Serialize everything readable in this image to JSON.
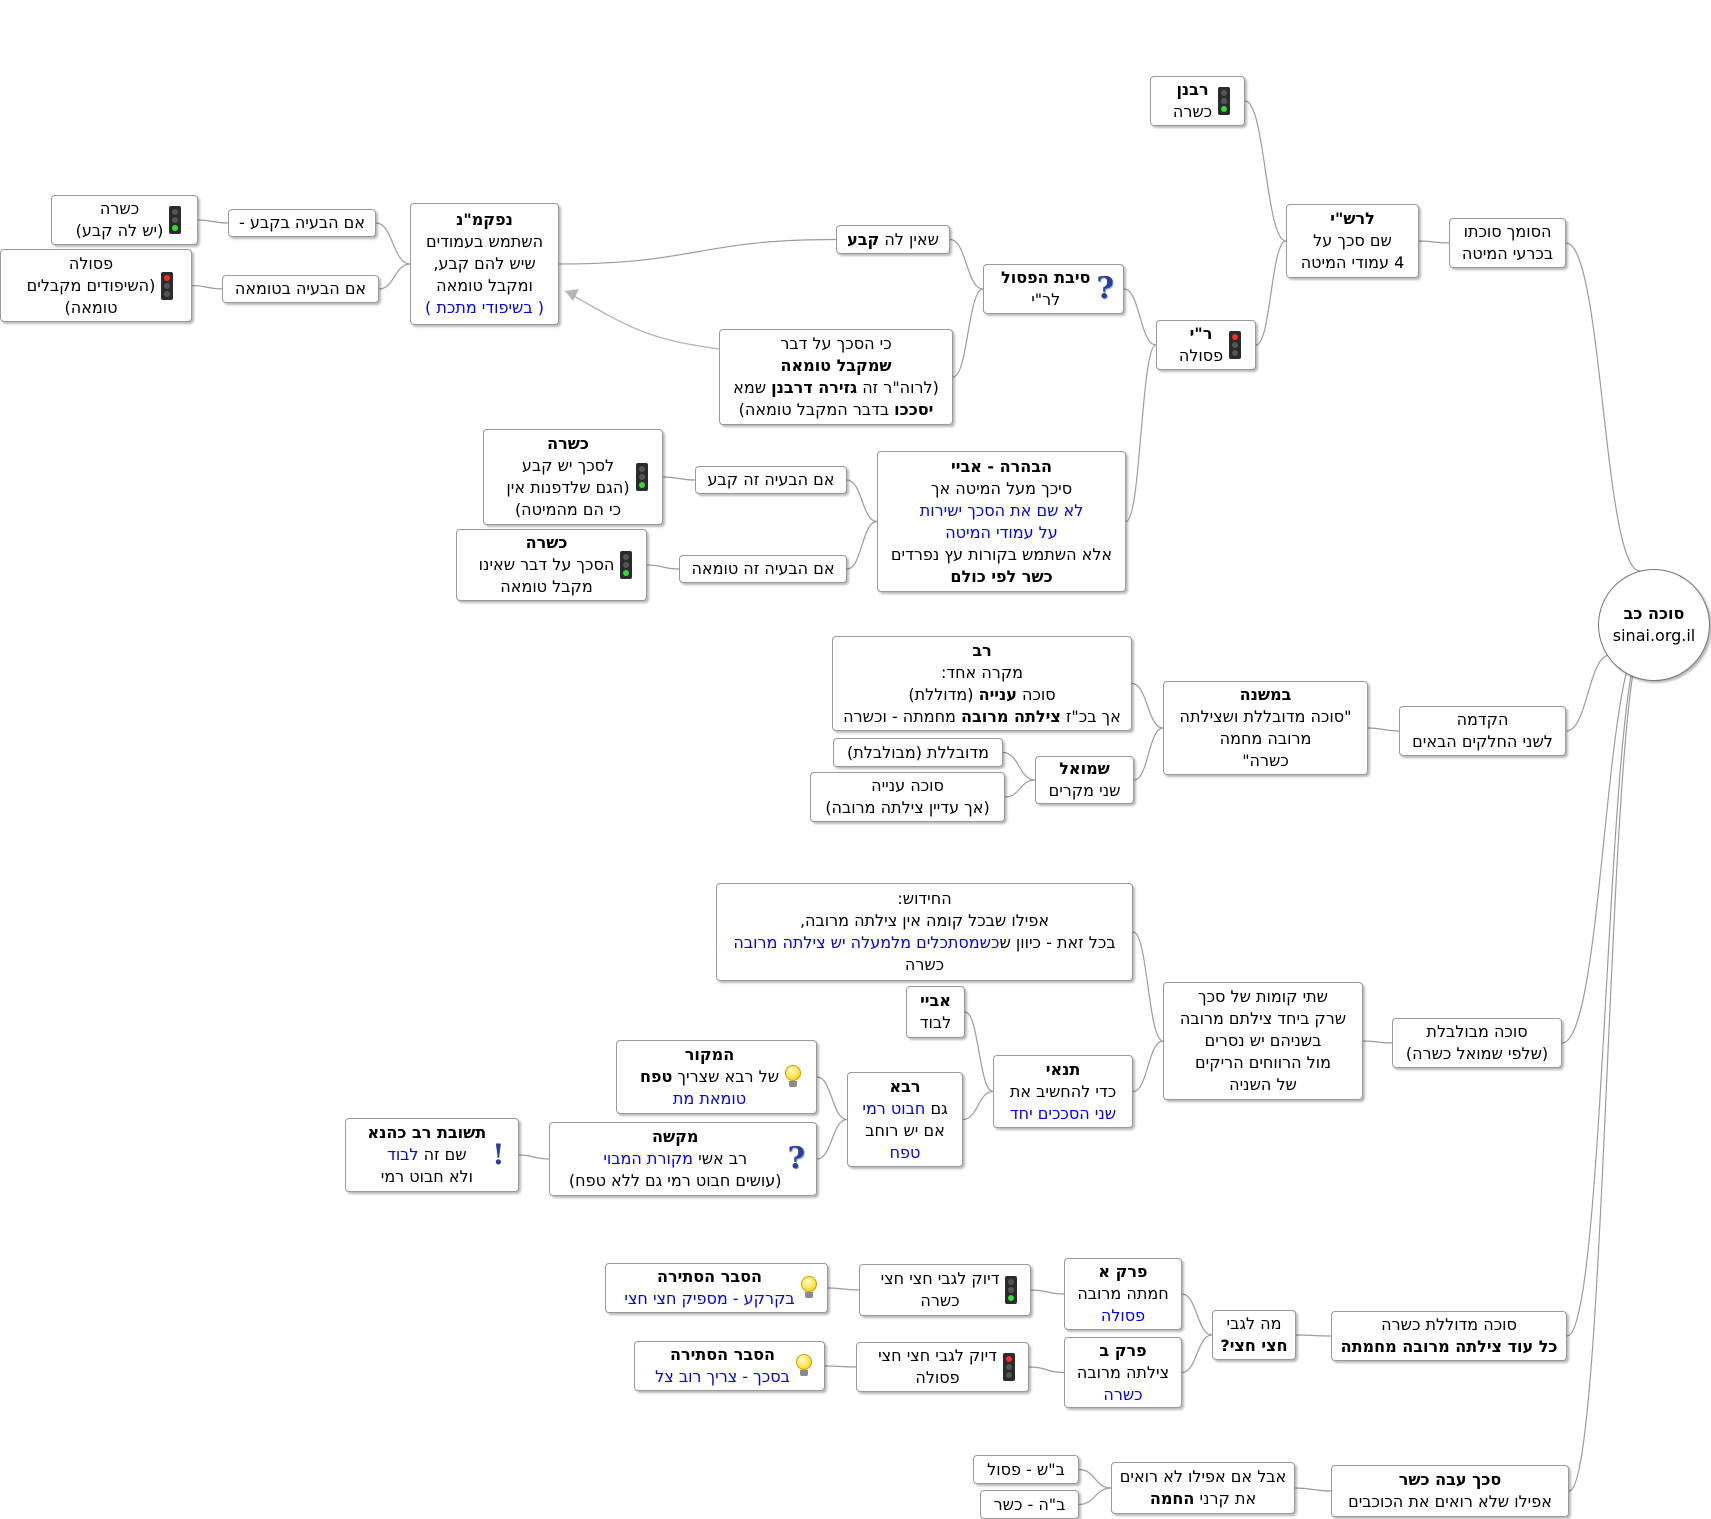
{
  "map": {
    "root": {
      "lines": [
        [
          {
            "t": "סוכה כב",
            "b": true
          }
        ],
        [
          {
            "t": "sinai.org.il"
          }
        ]
      ]
    },
    "n_mesukh": {
      "lines": [
        [
          {
            "t": "הסומך סוכתו"
          }
        ],
        [
          {
            "t": "בכרעי המיטה"
          }
        ]
      ]
    },
    "n_rashi_title": {
      "lines": [
        [
          {
            "t": "לרש\"י",
            "b": true
          }
        ],
        [
          {
            "t": "שם סכך על"
          }
        ],
        [
          {
            "t": "4 עמודי המיטה"
          }
        ]
      ]
    },
    "n_rabanan": {
      "icon": "traffic-light-green",
      "lines": [
        [
          {
            "t": "רבנן",
            "b": true
          }
        ],
        [
          {
            "t": "כשרה"
          }
        ]
      ]
    },
    "n_ri": {
      "icon": "traffic-light-red",
      "lines": [
        [
          {
            "t": "ר\"י",
            "b": true
          }
        ],
        [
          {
            "t": "פסולה"
          }
        ]
      ]
    },
    "n_sibat": {
      "icon": "question-mark",
      "lines": [
        [
          {
            "t": "סיבת הפסול",
            "b": true
          }
        ],
        [
          {
            "t": "לר\"י"
          }
        ]
      ]
    },
    "n_shein": {
      "lines": [
        [
          {
            "t": "שאין לה "
          },
          {
            "t": "קבע",
            "b": true
          }
        ]
      ]
    },
    "n_nafkamin": {
      "lines": [
        [
          {
            "t": "נפקמ\"נ",
            "b": true
          }
        ],
        [
          {
            "t": "השתמש בעמודים"
          }
        ],
        [
          {
            "t": "שיש להם קבע,"
          }
        ],
        [
          {
            "t": "ומקבל טומאה"
          }
        ],
        [
          {
            "t": "( בשיפודי מתכת )",
            "blue": true
          }
        ]
      ]
    },
    "n_kevaa": {
      "lines": [
        [
          {
            "t": "אם הבעיה בקבע -"
          }
        ]
      ]
    },
    "n_tumaa": {
      "lines": [
        [
          {
            "t": "אם הבעיה בטומאה"
          }
        ]
      ]
    },
    "n_kshera1": {
      "icon": "traffic-light-green",
      "lines": [
        [
          {
            "t": "כשרה"
          }
        ],
        [
          {
            "t": "(יש לה קבע)"
          }
        ]
      ]
    },
    "n_psula1": {
      "icon": "traffic-light-red",
      "lines": [
        [
          {
            "t": "פסולה"
          }
        ],
        [
          {
            "t": "(השיפודים מקבלים"
          }
        ],
        [
          {
            "t": "טומאה)"
          }
        ]
      ]
    },
    "n_ki_sekhakh": {
      "lines": [
        [
          {
            "t": "כי הסכך על דבר"
          }
        ],
        [
          {
            "t": "שמקבל טומאה",
            "b": true
          }
        ],
        [
          {
            "t": "(לרוה\"ר זה "
          },
          {
            "t": "גזירה דרבנן",
            "b": true
          },
          {
            "t": "  שמא"
          }
        ],
        [
          {
            "t": "יסככו",
            "b": true
          },
          {
            "t": " בדבר המקבל טומאה)"
          }
        ]
      ]
    },
    "n_habahara": {
      "lines": [
        [
          {
            "t": "הבהרה - אביי",
            "b": true
          }
        ],
        [
          {
            "t": "סיכך מעל המיטה אך"
          }
        ],
        [
          {
            "t": "לא שם את הסכך ישירות",
            "blue": true
          }
        ],
        [
          {
            "t": "על עמודי המיטה",
            "blue": true
          }
        ],
        [
          {
            "t": "אלא השתמש בקורות עץ נפרדים"
          }
        ],
        [
          {
            "t": "כשר לפי כולם",
            "b": true
          }
        ]
      ]
    },
    "n_im_kevaa": {
      "lines": [
        [
          {
            "t": "אם הבעיה זה קבע"
          }
        ]
      ]
    },
    "n_im_tumaa": {
      "lines": [
        [
          {
            "t": "אם הבעיה זה טומאה"
          }
        ]
      ]
    },
    "n_kshera2": {
      "icon": "traffic-light-green",
      "lines": [
        [
          {
            "t": "כשרה",
            "b": true
          }
        ],
        [
          {
            "t": "לסכך יש קבע"
          }
        ],
        [
          {
            "t": "(הגם שלדפנות אין"
          }
        ],
        [
          {
            "t": "כי הם מהמיטה)"
          }
        ]
      ]
    },
    "n_kshera3": {
      "icon": "traffic-light-green",
      "lines": [
        [
          {
            "t": "כשרה",
            "b": true
          }
        ],
        [
          {
            "t": "הסכך על דבר שאינו"
          }
        ],
        [
          {
            "t": "מקבל טומאה"
          }
        ]
      ]
    },
    "n_hakdama": {
      "lines": [
        [
          {
            "t": "הקדמה"
          }
        ],
        [
          {
            "t": "לשני החלקים הבאים"
          }
        ]
      ]
    },
    "n_bamishna": {
      "lines": [
        [
          {
            "t": "במשנה",
            "b": true
          }
        ],
        [
          {
            "t": "\"סוכה מדובללת ושצילתה"
          }
        ],
        [
          {
            "t": "מרובה מחמה"
          }
        ],
        [
          {
            "t": "כשרה\""
          }
        ]
      ]
    },
    "n_rav": {
      "lines": [
        [
          {
            "t": "רב",
            "b": true
          }
        ],
        [
          {
            "t": "מקרה אחד:"
          }
        ],
        [
          {
            "t": "סוכה "
          },
          {
            "t": "ענייה",
            "b": true
          },
          {
            "t": "  (מדוללת)"
          }
        ],
        [
          {
            "t": "אך בכ\"ז "
          },
          {
            "t": "צילתה מרובה",
            "b": true
          },
          {
            "t": " מחמתה - וכשרה"
          }
        ]
      ]
    },
    "n_shmuel": {
      "lines": [
        [
          {
            "t": "שמואל",
            "b": true
          }
        ],
        [
          {
            "t": "שני מקרים"
          }
        ]
      ]
    },
    "n_meduvlelet": {
      "lines": [
        [
          {
            "t": "מדובללת (מבולבלת)"
          }
        ]
      ]
    },
    "n_sukka_aniya": {
      "lines": [
        [
          {
            "t": "סוכה ענייה"
          }
        ],
        [
          {
            "t": "(אך עדיין צילתה מרובה)"
          }
        ]
      ]
    },
    "n_mevulbelet": {
      "lines": [
        [
          {
            "t": "סוכה מבולבלת"
          }
        ],
        [
          {
            "t": "(שלפי שמואל כשרה)"
          }
        ]
      ]
    },
    "n_shtei_komot": {
      "lines": [
        [
          {
            "t": "שתי קומות של סכך"
          }
        ],
        [
          {
            "t": "שרק ביחד צילתם מרובה"
          }
        ],
        [
          {
            "t": "בשניהם יש נסרים"
          }
        ],
        [
          {
            "t": "מול הרווחים הריקים"
          }
        ],
        [
          {
            "t": "של השניה"
          }
        ]
      ]
    },
    "n_hachidush": {
      "lines": [
        [
          {
            "t": "החידוש:"
          }
        ],
        [
          {
            "t": "אפילו שבכל קומה אין צילתה מרובה,"
          }
        ],
        [
          {
            "t": "בכל זאת - כיוון ש"
          },
          {
            "t": "כשמסתכלים מלמעלה יש צילתה מרובה",
            "blue": true
          }
        ],
        [
          {
            "t": "כשרה"
          }
        ]
      ]
    },
    "n_tanai": {
      "lines": [
        [
          {
            "t": "תנאי",
            "b": true
          }
        ],
        [
          {
            "t": "כדי להחשיב את"
          }
        ],
        [
          {
            "t": "שני הסככים יחד",
            "blue": true
          }
        ]
      ]
    },
    "n_abaye": {
      "lines": [
        [
          {
            "t": "אביי",
            "b": true
          }
        ],
        [
          {
            "t": "לבוד"
          }
        ]
      ]
    },
    "n_rava": {
      "lines": [
        [
          {
            "t": "רבא",
            "b": true
          }
        ],
        [
          {
            "t": "גם "
          },
          {
            "t": "חבוט רמי",
            "blue": true
          }
        ],
        [
          {
            "t": "אם יש רוחב"
          }
        ],
        [
          {
            "t": "טפח",
            "blue": true
          }
        ]
      ]
    },
    "n_hamakor": {
      "icon": "light-bulb",
      "lines": [
        [
          {
            "t": "המקור",
            "b": true
          }
        ],
        [
          {
            "t": "של רבא שצריך "
          },
          {
            "t": "טפח",
            "b": true
          }
        ],
        [
          {
            "t": "טומאת מת",
            "blue": true
          }
        ]
      ]
    },
    "n_kushya": {
      "icon": "question-mark",
      "lines": [
        [
          {
            "t": "מקשה",
            "b": true
          }
        ],
        [
          {
            "t": "רב אשי "
          },
          {
            "t": "מקורת המבוי",
            "blue": true
          }
        ],
        [
          {
            "t": "(עושים חבוט רמי גם ללא טפח)"
          }
        ]
      ]
    },
    "n_tshuva": {
      "icon": "exclamation-mark",
      "lines": [
        [
          {
            "t": "תשובת רב כהנא",
            "b": true
          }
        ],
        [
          {
            "t": "שם זה "
          },
          {
            "t": "לבוד",
            "blue": true
          }
        ],
        [
          {
            "t": "ולא חבוט רמי"
          }
        ]
      ]
    },
    "n_meduvlelet_kshera": {
      "lines": [
        [
          {
            "t": "סוכה מדוללת כשרה"
          }
        ],
        [
          {
            "t": "כל עוד צילתה מרובה מחמתה",
            "b": true
          }
        ]
      ]
    },
    "n_ma_legabei": {
      "lines": [
        [
          {
            "t": "מה לגבי"
          }
        ],
        [
          {
            "t": "חצי חצי?",
            "b": true
          }
        ]
      ]
    },
    "n_perek_a": {
      "lines": [
        [
          {
            "t": "פרק א",
            "b": true
          }
        ],
        [
          {
            "t": "חמתה מרובה"
          }
        ],
        [
          {
            "t": "פסולה",
            "blue": true
          }
        ]
      ]
    },
    "n_perek_b": {
      "lines": [
        [
          {
            "t": "פרק ב",
            "b": true
          }
        ],
        [
          {
            "t": "צילתה מרובה"
          }
        ],
        [
          {
            "t": "כשרה",
            "blue": true
          }
        ]
      ]
    },
    "n_diyuk_kshera": {
      "icon": "traffic-light-green",
      "lines": [
        [
          {
            "t": "דיוק לגבי חצי חצי"
          }
        ],
        [
          {
            "t": "כשרה"
          }
        ]
      ]
    },
    "n_diyuk_psula": {
      "icon": "traffic-light-red",
      "lines": [
        [
          {
            "t": "דיוק לגבי חצי חצי"
          }
        ],
        [
          {
            "t": "פסולה"
          }
        ]
      ]
    },
    "n_hesber1": {
      "icon": "light-bulb",
      "lines": [
        [
          {
            "t": "הסבר הסתירה",
            "b": true
          }
        ],
        [
          {
            "t": "בקרקע - מספיק חצי חצי",
            "blue": true
          }
        ]
      ]
    },
    "n_hesber2": {
      "icon": "light-bulb",
      "lines": [
        [
          {
            "t": "הסבר הסתירה",
            "b": true
          }
        ],
        [
          {
            "t": "בסכך - צריך רוב צל",
            "blue": true
          }
        ]
      ]
    },
    "n_sekhakh_ave": {
      "lines": [
        [
          {
            "t": "סכך עבה כשר",
            "b": true
          }
        ],
        [
          {
            "t": "אפילו שלא רואים את הכוכבים"
          }
        ]
      ]
    },
    "n_aval": {
      "lines": [
        [
          {
            "t": "אבל אם אפילו לא רואים"
          }
        ],
        [
          {
            "t": "את קרני "
          },
          {
            "t": "החמה",
            "b": true
          }
        ]
      ]
    },
    "n_bs": {
      "lines": [
        [
          {
            "t": "ב\"ש - פסול"
          }
        ]
      ]
    },
    "n_bh": {
      "lines": [
        [
          {
            "t": "ב\"ה - כשר"
          }
        ]
      ]
    }
  }
}
